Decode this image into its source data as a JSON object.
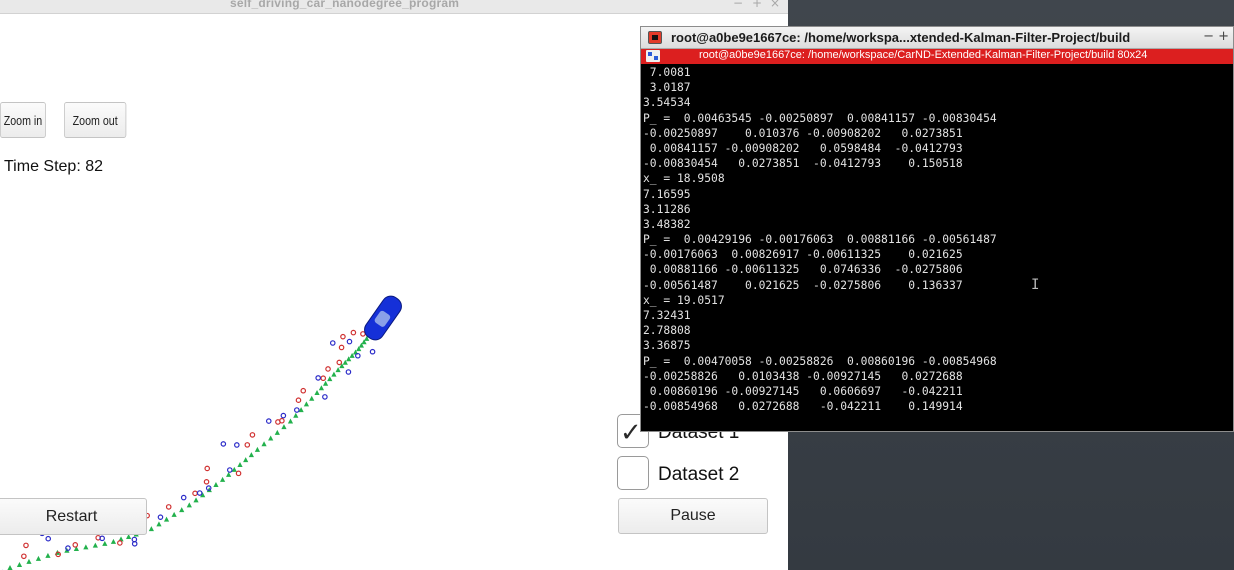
{
  "simulator": {
    "title": "self_driving_car_nanodegree_program",
    "wm_buttons": [
      "−",
      "+",
      "×"
    ],
    "zoom_in_label": "Zoom in",
    "zoom_out_label": "Zoom out",
    "time_step": "Time Step: 82",
    "restart_label": "Restart",
    "pause_label": "Pause",
    "datasets": [
      {
        "label": "Dataset 1",
        "checked": true
      },
      {
        "label": "Dataset 2",
        "checked": false
      }
    ],
    "colors": {
      "ground_truth": "#22b14c",
      "radar": "#d03030",
      "lidar": "#2a2ac8",
      "car": "#1530d8"
    }
  },
  "terminal": {
    "window_title": "root@a0be9e1667ce: /home/workspa...xtended-Kalman-Filter-Project/build",
    "wm_buttons": "− +",
    "tab_title": "root@a0be9e1667ce: /home/workspace/CarND-Extended-Kalman-Filter-Project/build 80x24",
    "lines": [
      " 7.0081",
      " 3.0187",
      "3.54534",
      "P_ =  0.00463545 -0.00250897  0.00841157 -0.00830454",
      "-0.00250897    0.010376 -0.00908202   0.0273851",
      " 0.00841157 -0.00908202   0.0598484  -0.0412793",
      "-0.00830454   0.0273851  -0.0412793    0.150518",
      "x_ = 18.9508",
      "7.16595",
      "3.11286",
      "3.48382",
      "P_ =  0.00429196 -0.00176063  0.00881166 -0.00561487",
      "-0.00176063  0.00826917 -0.00611325    0.021625",
      " 0.00881166 -0.00611325   0.0746336  -0.0275806",
      "-0.00561487    0.021625  -0.0275806    0.136337",
      "x_ = 19.0517",
      "7.32431",
      "2.78808",
      "3.36875",
      "P_ =  0.00470058 -0.00258826  0.00860196 -0.00854968",
      "-0.00258826   0.0103438 -0.00927145   0.0272688",
      " 0.00860196 -0.00927145   0.0606697   -0.042211",
      "-0.00854968   0.0272688   -0.042211    0.149914"
    ]
  }
}
